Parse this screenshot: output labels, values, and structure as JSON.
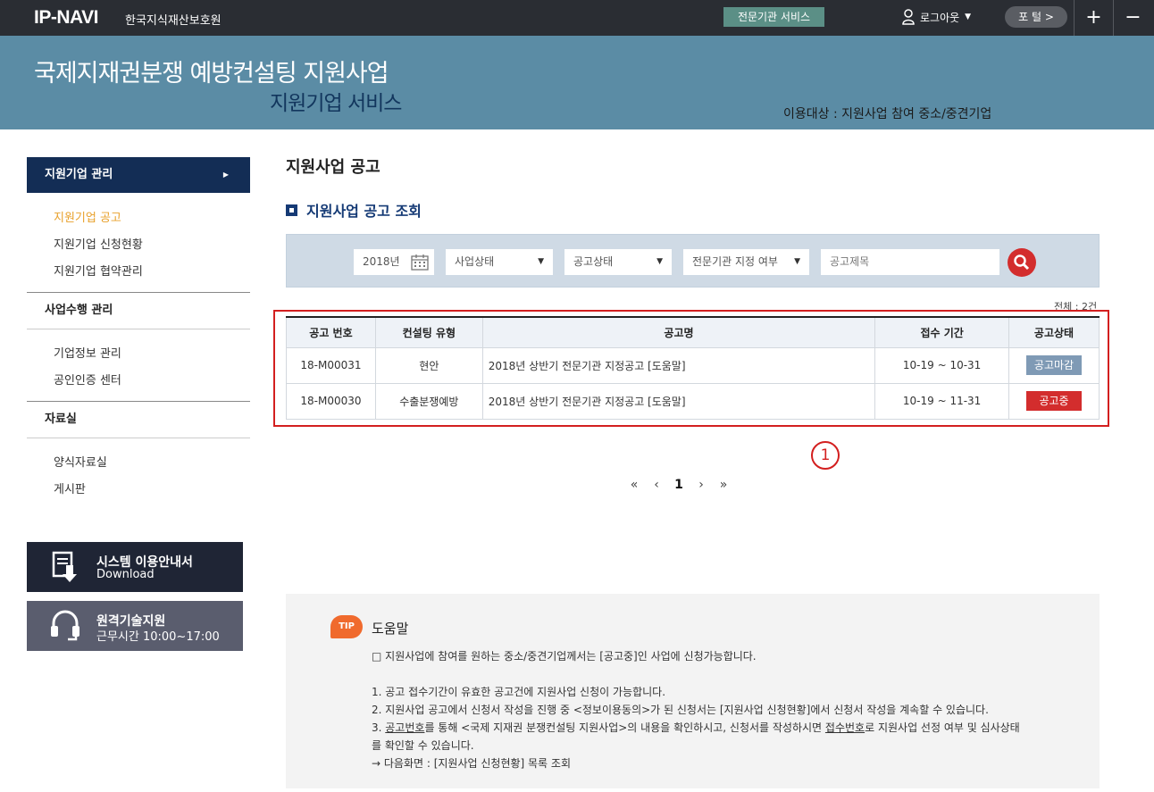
{
  "topbar": {
    "logo": "IP-NAVI",
    "org_name": "한국지식재산보호원",
    "expert_service": "전문기관 서비스",
    "logout": "로그아웃",
    "portal": "포 털 >",
    "plus": "+",
    "minus": "−"
  },
  "banner": {
    "title": "국제지재권분쟁 예방컨설팅 지원사업",
    "subtitle": "지원기업 서비스",
    "target": "이용대상 : 지원사업 참여 중소/중견기업"
  },
  "sidebar": {
    "menu_title": "지원기업 관리",
    "items_group1": [
      "지원기업 공고",
      "지원기업 신청현황",
      "지원기업 협약관리"
    ],
    "section2": "사업수행 관리",
    "items_group2": [
      "기업정보 관리",
      "공인인증 센터"
    ],
    "section3": "자료실",
    "items_group3": [
      "양식자료실",
      "게시판"
    ],
    "guide_btn": {
      "line1": "시스템 이용안내서",
      "line2": "Download"
    },
    "remote_btn": {
      "line1": "원격기술지원",
      "line2": "근무시간 10:00~17:00"
    }
  },
  "main": {
    "page_title": "지원사업 공고",
    "section_title": "지원사업 공고 조회",
    "search": {
      "year": "2018년",
      "business_status": "사업상태",
      "notice_status": "공고상태",
      "expert_designation": "전문기관 지정 여부",
      "title_placeholder": "공고제목"
    },
    "total": "전체 : 2건",
    "table": {
      "headers": [
        "공고 번호",
        "컨설팅 유형",
        "공고명",
        "접수 기간",
        "공고상태"
      ],
      "rows": [
        {
          "no": "18-M00031",
          "type": "현안",
          "name": "2018년 상반기 전문기관 지정공고  [도움말]",
          "period": "10-19 ~ 10-31",
          "status": "공고마감"
        },
        {
          "no": "18-M00030",
          "type": "수출분쟁예방",
          "name": "2018년 상반기 전문기관 지정공고  [도움말]",
          "period": "10-19 ~ 11-31",
          "status": "공고중"
        }
      ]
    },
    "marker": "1",
    "pager": {
      "first": "«",
      "prev": "‹",
      "current": "1",
      "next": "›",
      "last": "»"
    }
  },
  "help": {
    "badge": "TIP",
    "title": "도움말",
    "intro": "□ 지원사업에 참여를 원하는 중소/중견기업께서는 [공고중]인 사업에 신청가능합니다.",
    "line1": "1. 공고 접수기간이 유효한 공고건에 지원사업 신청이 가능합니다.",
    "line2": "2. 지원사업 공고에서 신청서 작성을 진행 중 <정보이용동의>가 된 신청서는 [지원사업 신청현황]에서 신청서 작성을 계속할 수 있습니다.",
    "line3_a": "3. ",
    "line3_b": "공고번호",
    "line3_c": "를 통해 <국제 지재권 분쟁컨설팅 지원사업>의 내용을 확인하시고, 신청서를 작성하시면 ",
    "line3_d": "접수번호",
    "line3_e": "로 지원사업 선정 여부 및 심사상태",
    "line4": "를 확인할 수 있습니다.",
    "line5": "→ 다음화면 : [지원사업 신청현황] 목록 조회"
  },
  "colors": {
    "topbar": "#2a2d33",
    "banner": "#5b8ca5",
    "navy": "#132d55",
    "accent_red": "#d32d2d",
    "active_link": "#e8a02a"
  }
}
